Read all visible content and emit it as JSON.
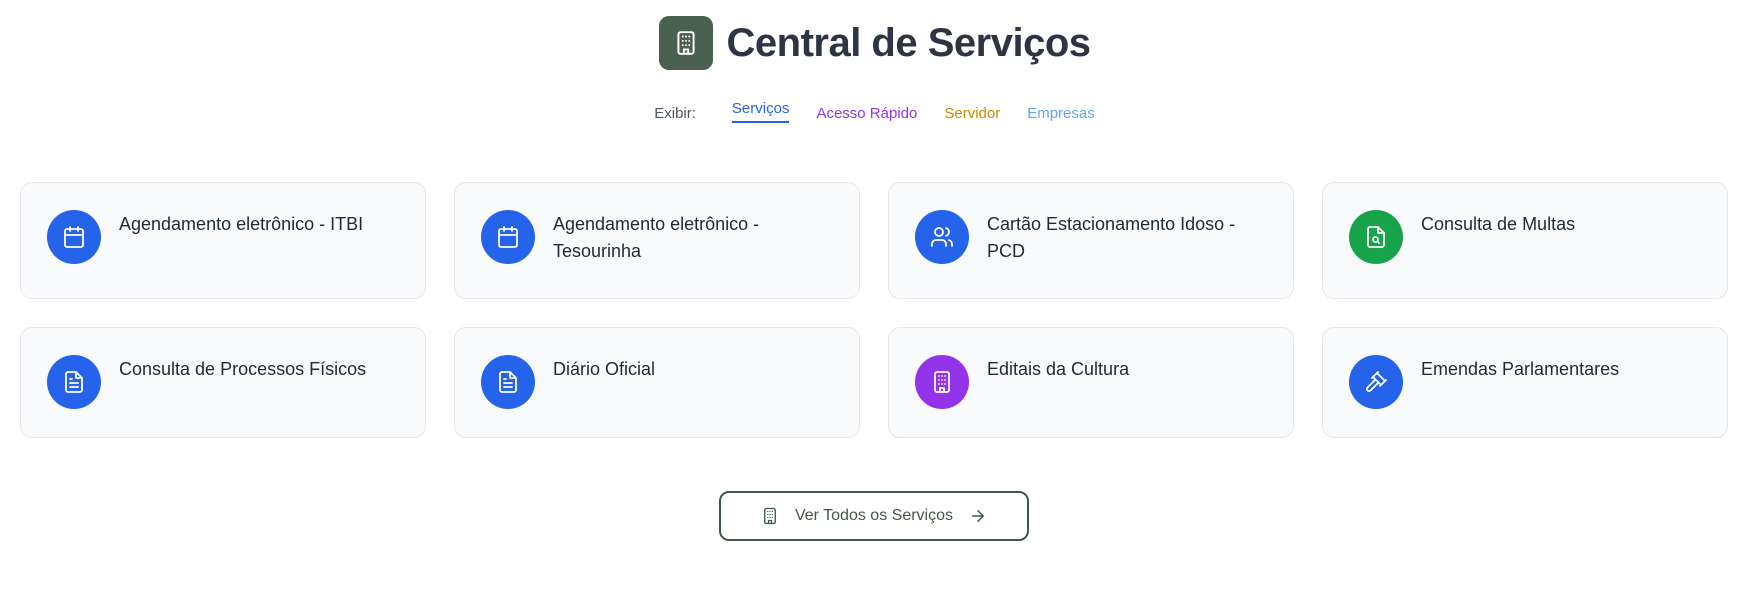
{
  "header": {
    "title": "Central de Serviços",
    "logo_icon": "building-icon",
    "logo_color": "#4a6150"
  },
  "filter": {
    "label": "Exibir:",
    "tabs": [
      {
        "label": "Serviços",
        "active": true,
        "color": "#2563eb"
      },
      {
        "label": "Acesso Rápido",
        "active": false,
        "color": "#9333ea"
      },
      {
        "label": "Servidor",
        "active": false,
        "color": "#ca8a04"
      },
      {
        "label": "Empresas",
        "active": false,
        "color": "#60a5fa"
      }
    ]
  },
  "services": [
    {
      "title": "Agendamento eletrônico - ITBI",
      "icon": "calendar-icon",
      "color": "#2563eb"
    },
    {
      "title": "Agendamento eletrônico - Tesourinha",
      "icon": "calendar-icon",
      "color": "#2563eb"
    },
    {
      "title": "Cartão Estacionamento Idoso - PCD",
      "icon": "users-icon",
      "color": "#2563eb"
    },
    {
      "title": "Consulta de Multas",
      "icon": "file-search-icon",
      "color": "#16a34a"
    },
    {
      "title": "Consulta de Processos Físicos",
      "icon": "file-text-icon",
      "color": "#2563eb"
    },
    {
      "title": "Diário Oficial",
      "icon": "file-text-icon",
      "color": "#2563eb"
    },
    {
      "title": "Editais da Cultura",
      "icon": "building-icon",
      "color": "#9333ea"
    },
    {
      "title": "Emendas Parlamentares",
      "icon": "gavel-icon",
      "color": "#2563eb"
    }
  ],
  "footer_button": {
    "label": "Ver Todos os Serviços",
    "icon": "building-icon",
    "trailing_icon": "arrow-right-icon"
  }
}
